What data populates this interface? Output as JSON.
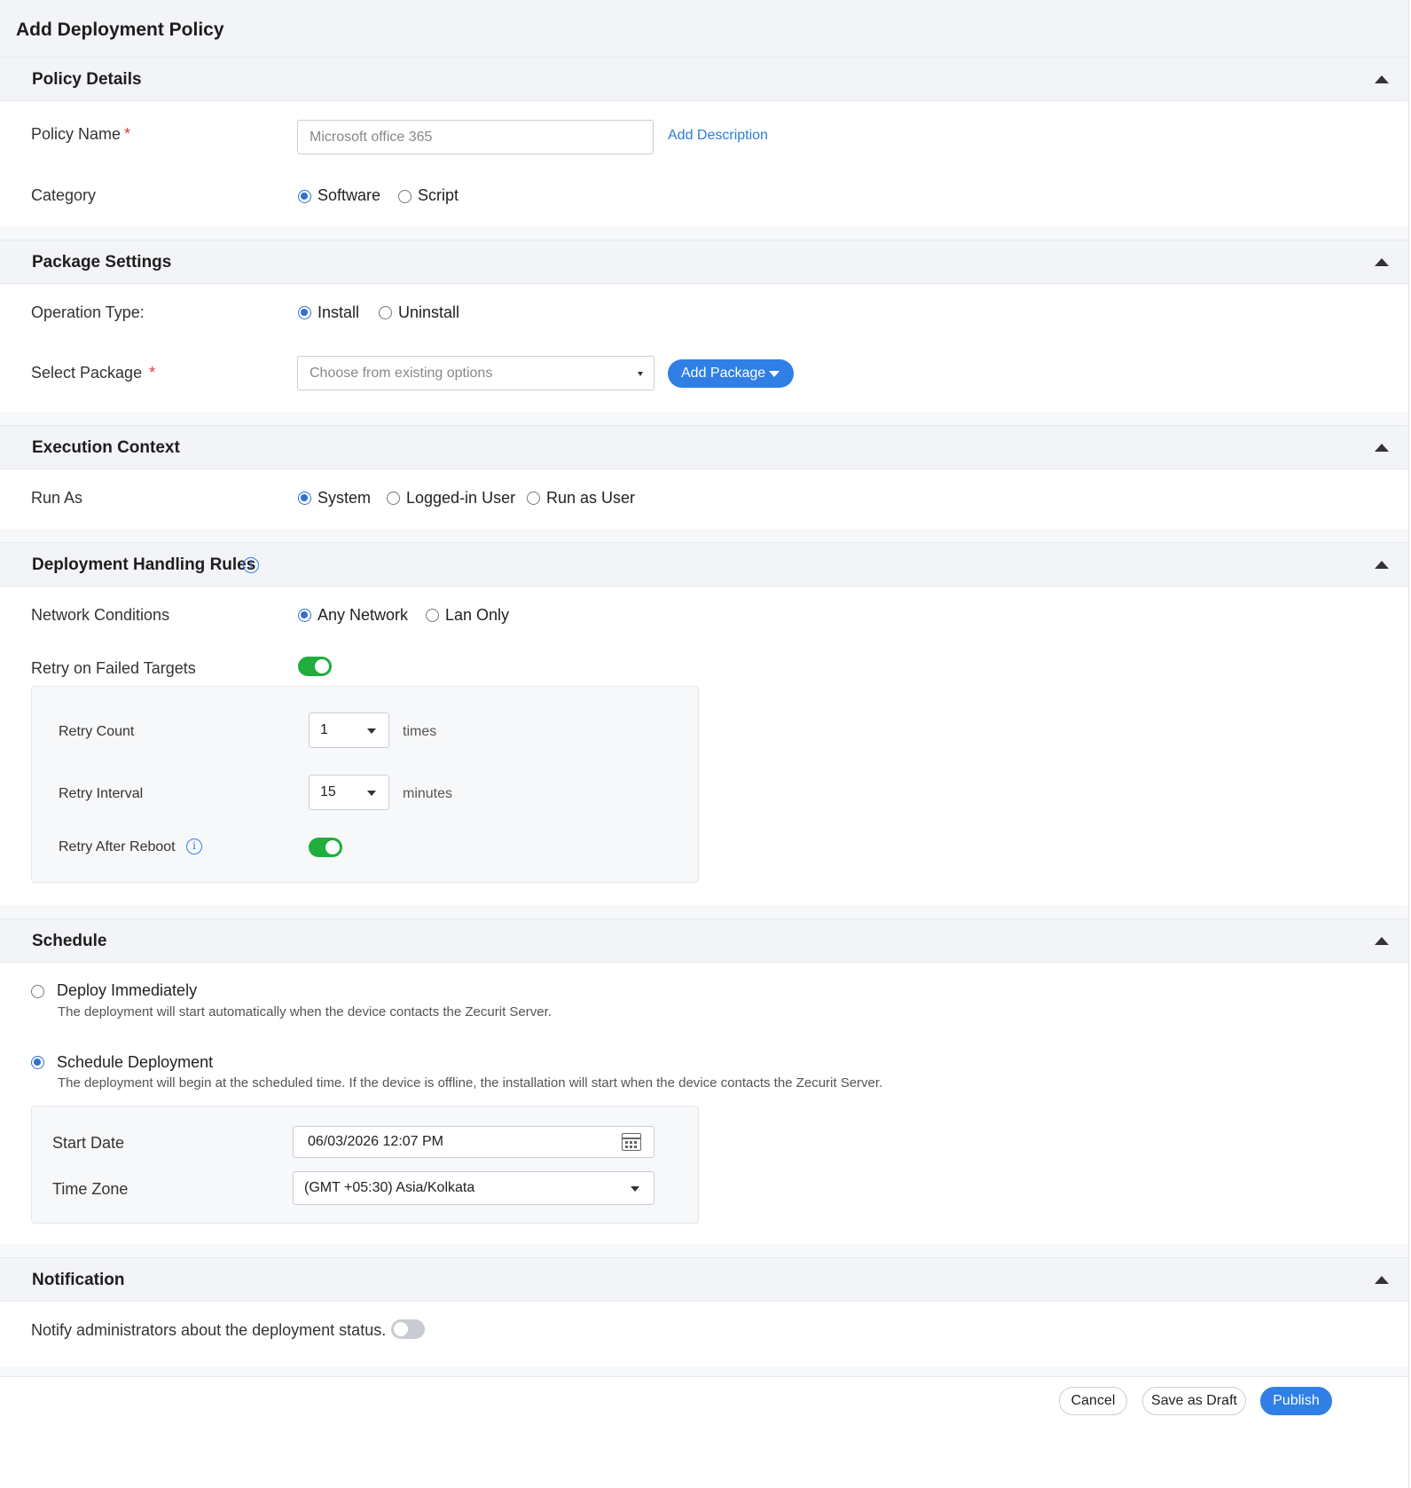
{
  "page": {
    "title": "Add Deployment Policy"
  },
  "policy_details": {
    "title": "Policy Details",
    "policy_name_label": "Policy Name",
    "required_mark": "*",
    "policy_name_placeholder": "Microsoft office 365",
    "add_description": "Add Description",
    "category_label": "Category",
    "category_options": [
      "Software",
      "Script"
    ],
    "category_selected": "Software"
  },
  "package_settings": {
    "title": "Package Settings",
    "operation_type_label": "Operation Type:",
    "operation_options": [
      "Install",
      "Uninstall"
    ],
    "operation_selected": "Install",
    "select_package_label": "Select Package",
    "select_package_placeholder": "Choose from existing options",
    "add_package_button": "Add Package"
  },
  "execution_context": {
    "title": "Execution Context",
    "run_as_label": "Run As",
    "run_as_options": [
      "System",
      "Logged-in User",
      "Run as User"
    ],
    "run_as_selected": "System"
  },
  "deployment_rules": {
    "title": "Deployment Handling Rules",
    "network_label": "Network Conditions",
    "network_options": [
      "Any Network",
      "Lan Only"
    ],
    "network_selected": "Any Network",
    "retry_failed_label": "Retry on Failed Targets",
    "retry_failed_enabled": true,
    "retry_count_label": "Retry Count",
    "retry_count_value": "1",
    "retry_count_unit": "times",
    "retry_interval_label": "Retry Interval",
    "retry_interval_value": "15",
    "retry_interval_unit": "minutes",
    "retry_after_reboot_label": "Retry After Reboot",
    "retry_after_reboot_enabled": true
  },
  "schedule": {
    "title": "Schedule",
    "deploy_immediately_label": "Deploy Immediately",
    "deploy_immediately_desc": "The deployment will start automatically when the device contacts the Zecurit Server.",
    "schedule_deployment_label": "Schedule Deployment",
    "schedule_deployment_desc": "The deployment will begin at the scheduled time. If the device is offline, the installation will start when the device contacts the Zecurit Server.",
    "selected": "Schedule Deployment",
    "start_date_label": "Start Date",
    "start_date_value": "06/03/2026 12:07 PM",
    "time_zone_label": "Time Zone",
    "time_zone_value": "(GMT +05:30) Asia/Kolkata"
  },
  "notification": {
    "title": "Notification",
    "notify_label": "Notify administrators about the deployment status.",
    "notify_enabled": false
  },
  "footer": {
    "cancel": "Cancel",
    "save_draft": "Save as Draft",
    "publish": "Publish"
  },
  "colors": {
    "accent": "#2f7fe6",
    "toggle_on": "#1fae3c",
    "required": "#e53935"
  }
}
